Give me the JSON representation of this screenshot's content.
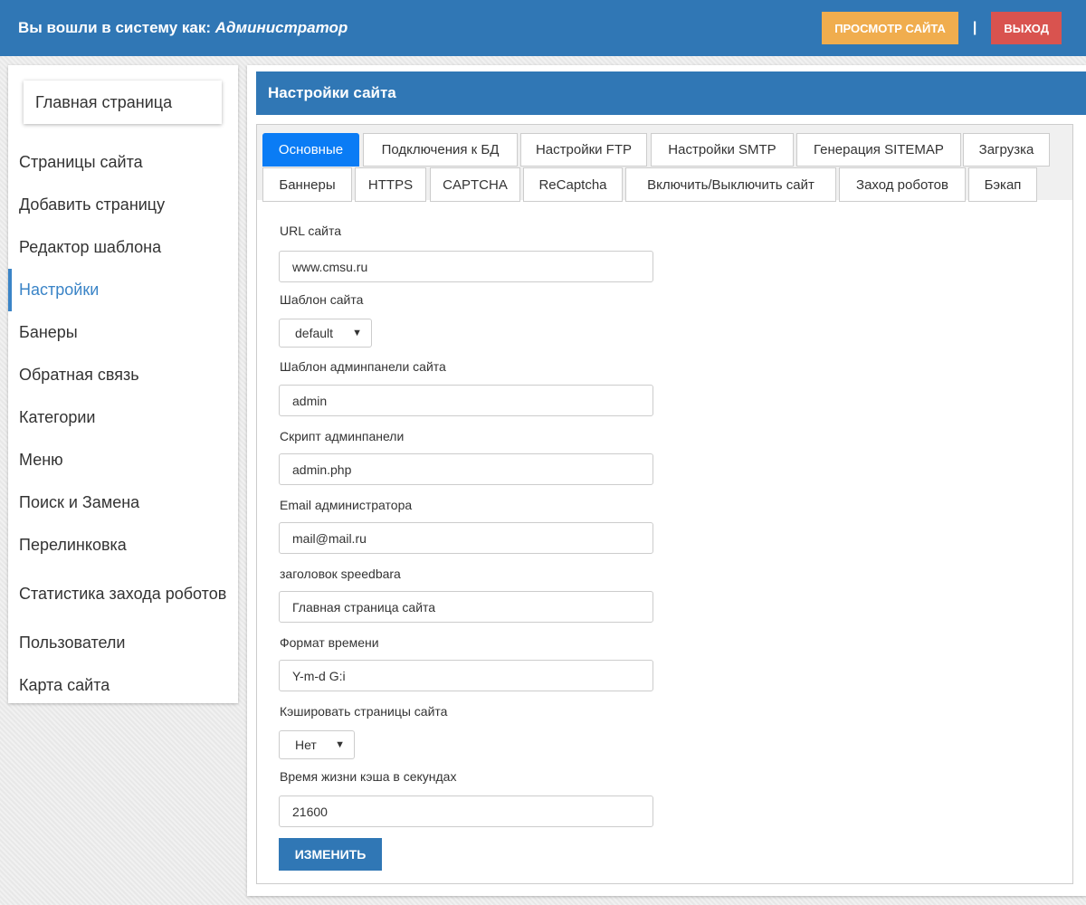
{
  "topbar": {
    "login_prefix": "Вы вошли в систему как:",
    "role": "Администратор",
    "view_site_label": "Просмотр сайта",
    "separator": "|",
    "exit_label": "Выход",
    "colors": {
      "bar": "#3077b5",
      "view": "#f0ad4e",
      "exit": "#d9534f"
    }
  },
  "sidebar": {
    "home": "Главная страница",
    "items": [
      {
        "label": "Страницы сайта"
      },
      {
        "label": "Добавить страницу"
      },
      {
        "label": "Редактор шаблона"
      },
      {
        "label": "Настройки",
        "active": true
      },
      {
        "label": "Банеры"
      },
      {
        "label": "Обратная связь"
      },
      {
        "label": "Категории"
      },
      {
        "label": "Меню"
      },
      {
        "label": "Поиск и Замена"
      },
      {
        "label": "Перелинковка"
      },
      {
        "label": "Статистика захода роботов"
      },
      {
        "label": "Пользователи"
      },
      {
        "label": "Карта сайта"
      }
    ]
  },
  "main": {
    "title": "Настройки сайта",
    "tabs": [
      "Основные",
      "Подключения к БД",
      "Настройки FTP",
      "Настройки SMTP",
      "Генерация SITEMAP",
      "Загрузка",
      "Баннеры",
      "HTTPS",
      "CAPTCHA",
      "ReCaptcha",
      "Включить/Выключить сайт",
      "Заход роботов",
      "Бэкап"
    ],
    "active_tab": "Основные",
    "form": {
      "url_label": "URL сайта",
      "url_value": "www.cmsu.ru",
      "template_label": "Шаблон сайта",
      "template_value": "default",
      "admin_template_label": "Шаблон админпанели сайта",
      "admin_template_value": "admin",
      "admin_script_label": "Скрипт админпанели",
      "admin_script_value": "admin.php",
      "email_label": "Email администратора",
      "email_value": "mail@mail.ru",
      "speedbar_label": "заголовок speedbara",
      "speedbar_value": "Главная страница сайта",
      "time_format_label": "Формат времени",
      "time_format_value": "Y-m-d G:i",
      "cache_label": "Кэшировать страницы сайта",
      "cache_value": "Нет",
      "cache_ttl_label": "Время жизни кэша в секундах",
      "cache_ttl_value": "21600",
      "submit_label": "Изменить"
    }
  }
}
